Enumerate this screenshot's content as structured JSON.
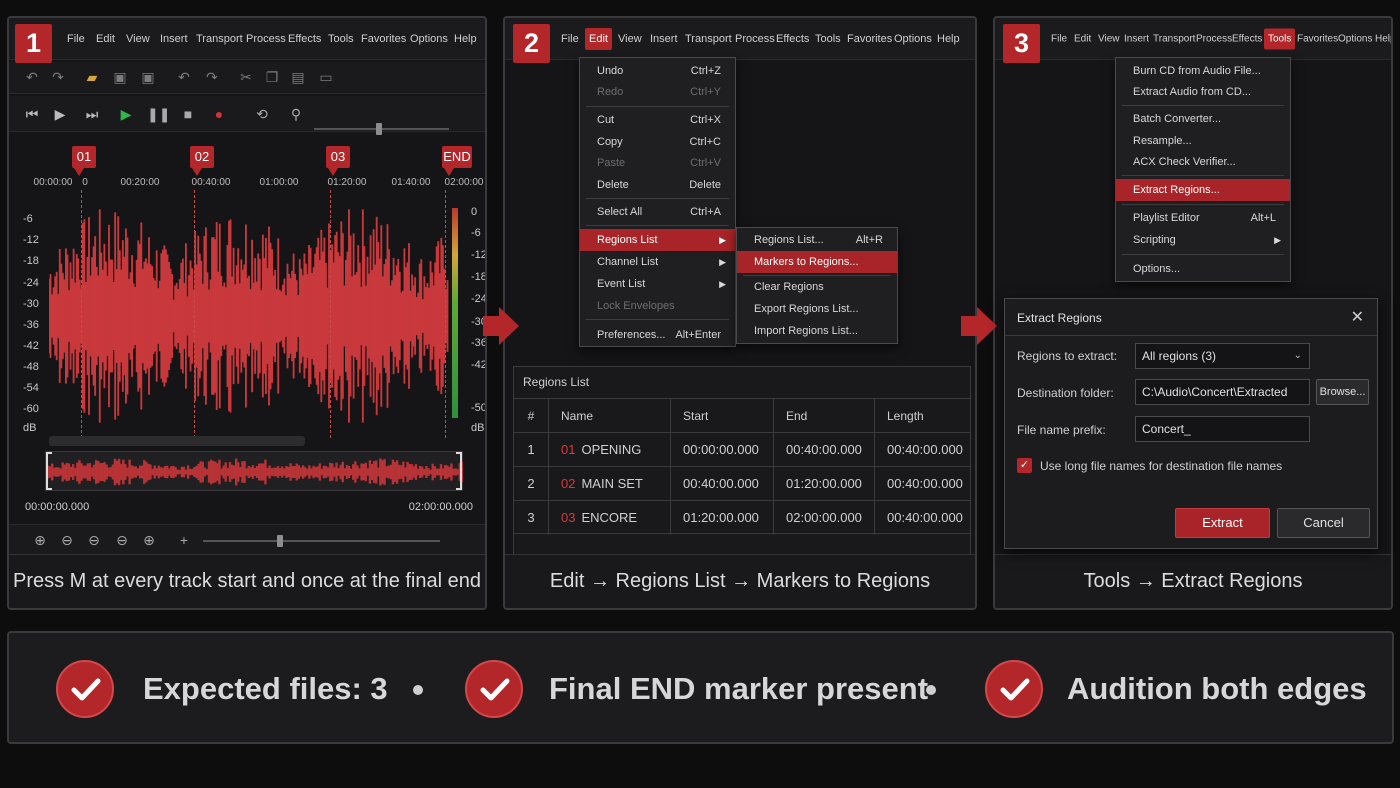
{
  "accent_color": "#b3262a",
  "panel1": {
    "step": "1",
    "menu": [
      "File",
      "Edit",
      "View",
      "Insert",
      "Transport",
      "Process",
      "Effects",
      "Tools",
      "Favorites",
      "Options",
      "Help"
    ],
    "markers": [
      "01",
      "02",
      "03",
      "END"
    ],
    "ruler": [
      "00:00:00",
      "0",
      "00:20:00",
      "00:40:00",
      "01:00:00",
      "01:20:00",
      "01:40:00",
      "02:00:00"
    ],
    "db_left": [
      "-6",
      "-12",
      "-18",
      "-24",
      "-30",
      "-36",
      "-42",
      "-48",
      "-54",
      "-60",
      "dB"
    ],
    "db_right": [
      "0",
      "-6",
      "-12",
      "-18",
      "-24",
      "-30",
      "-36",
      "-42",
      "-50",
      "dB"
    ],
    "time_start": "00:00:00.000",
    "time_end": "02:00:00.000",
    "caption": "Press M at every track start and once at the final end"
  },
  "panel2": {
    "step": "2",
    "menu": [
      "File",
      "Edit",
      "View",
      "Insert",
      "Transport",
      "Process",
      "Effects",
      "Tools",
      "Favorites",
      "Options",
      "Help"
    ],
    "edit_menu": [
      {
        "label": "Undo",
        "shortcut": "Ctrl+Z",
        "disabled": false
      },
      {
        "label": "Redo",
        "shortcut": "Ctrl+Y",
        "disabled": true
      },
      {
        "label": "Cut",
        "shortcut": "Ctrl+X",
        "disabled": false
      },
      {
        "label": "Copy",
        "shortcut": "Ctrl+C",
        "disabled": false
      },
      {
        "label": "Paste",
        "shortcut": "Ctrl+V",
        "disabled": true
      },
      {
        "label": "Delete",
        "shortcut": "Delete",
        "disabled": false
      },
      {
        "label": "Select All",
        "shortcut": "Ctrl+A",
        "disabled": false
      },
      {
        "label": "Regions List",
        "shortcut": "",
        "disabled": false
      },
      {
        "label": "Channel List",
        "shortcut": "",
        "disabled": false
      },
      {
        "label": "Event List",
        "shortcut": "",
        "disabled": false
      },
      {
        "label": "Lock Envelopes",
        "shortcut": "",
        "disabled": true
      },
      {
        "label": "Preferences...",
        "shortcut": "Alt+Enter",
        "disabled": false
      }
    ],
    "submenu": [
      {
        "label": "Regions List...",
        "shortcut": "Alt+R"
      },
      {
        "label": "Markers to Regions...",
        "shortcut": ""
      },
      {
        "label": "Clear Regions",
        "shortcut": ""
      },
      {
        "label": "Export Regions List...",
        "shortcut": ""
      },
      {
        "label": "Import Regions List...",
        "shortcut": ""
      }
    ],
    "regions_title": "Regions List",
    "columns": [
      "#",
      "Name",
      "Start",
      "End",
      "Length"
    ],
    "rows": [
      {
        "idx": "1",
        "num": "01",
        "name": "OPENING",
        "start": "00:00:00.000",
        "end": "00:40:00.000",
        "length": "00:40:00.000"
      },
      {
        "idx": "2",
        "num": "02",
        "name": "MAIN SET",
        "start": "00:40:00.000",
        "end": "01:20:00.000",
        "length": "00:40:00.000"
      },
      {
        "idx": "3",
        "num": "03",
        "name": "ENCORE",
        "start": "01:20:00.000",
        "end": "02:00:00.000",
        "length": "00:40:00.000"
      }
    ],
    "caption": "Edit → Regions List → Markers to Regions"
  },
  "panel3": {
    "step": "3",
    "menu": [
      "File",
      "Edit",
      "View",
      "Insert",
      "Transport",
      "Process",
      "Effects",
      "Tools",
      "Favorites",
      "Options",
      "Help"
    ],
    "tools_menu": [
      {
        "label": "Burn CD from Audio File...",
        "shortcut": ""
      },
      {
        "label": "Extract Audio from CD...",
        "shortcut": ""
      },
      {
        "label": "Batch Converter...",
        "shortcut": ""
      },
      {
        "label": "Resample...",
        "shortcut": ""
      },
      {
        "label": "ACX Check Verifier...",
        "shortcut": ""
      },
      {
        "label": "Extract Regions...",
        "shortcut": ""
      },
      {
        "label": "Playlist Editor",
        "shortcut": "Alt+L"
      },
      {
        "label": "Scripting",
        "shortcut": ""
      },
      {
        "label": "Options...",
        "shortcut": ""
      }
    ],
    "dialog": {
      "title": "Extract Regions",
      "regions_label": "Regions to extract:",
      "regions_value": "All regions (3)",
      "dest_label": "Destination folder:",
      "dest_value": "C:\\Audio\\Concert\\Extracted",
      "browse": "Browse...",
      "prefix_label": "File name prefix:",
      "prefix_value": "Concert_",
      "checkbox_label": "Use long file names for destination file names",
      "checkbox_checked": true,
      "extract": "Extract",
      "cancel": "Cancel"
    },
    "caption": "Tools → Extract Regions"
  },
  "checklist": [
    {
      "text": "Expected files: 3"
    },
    {
      "text": "Final END marker present"
    },
    {
      "text": "Audition both edges"
    }
  ]
}
